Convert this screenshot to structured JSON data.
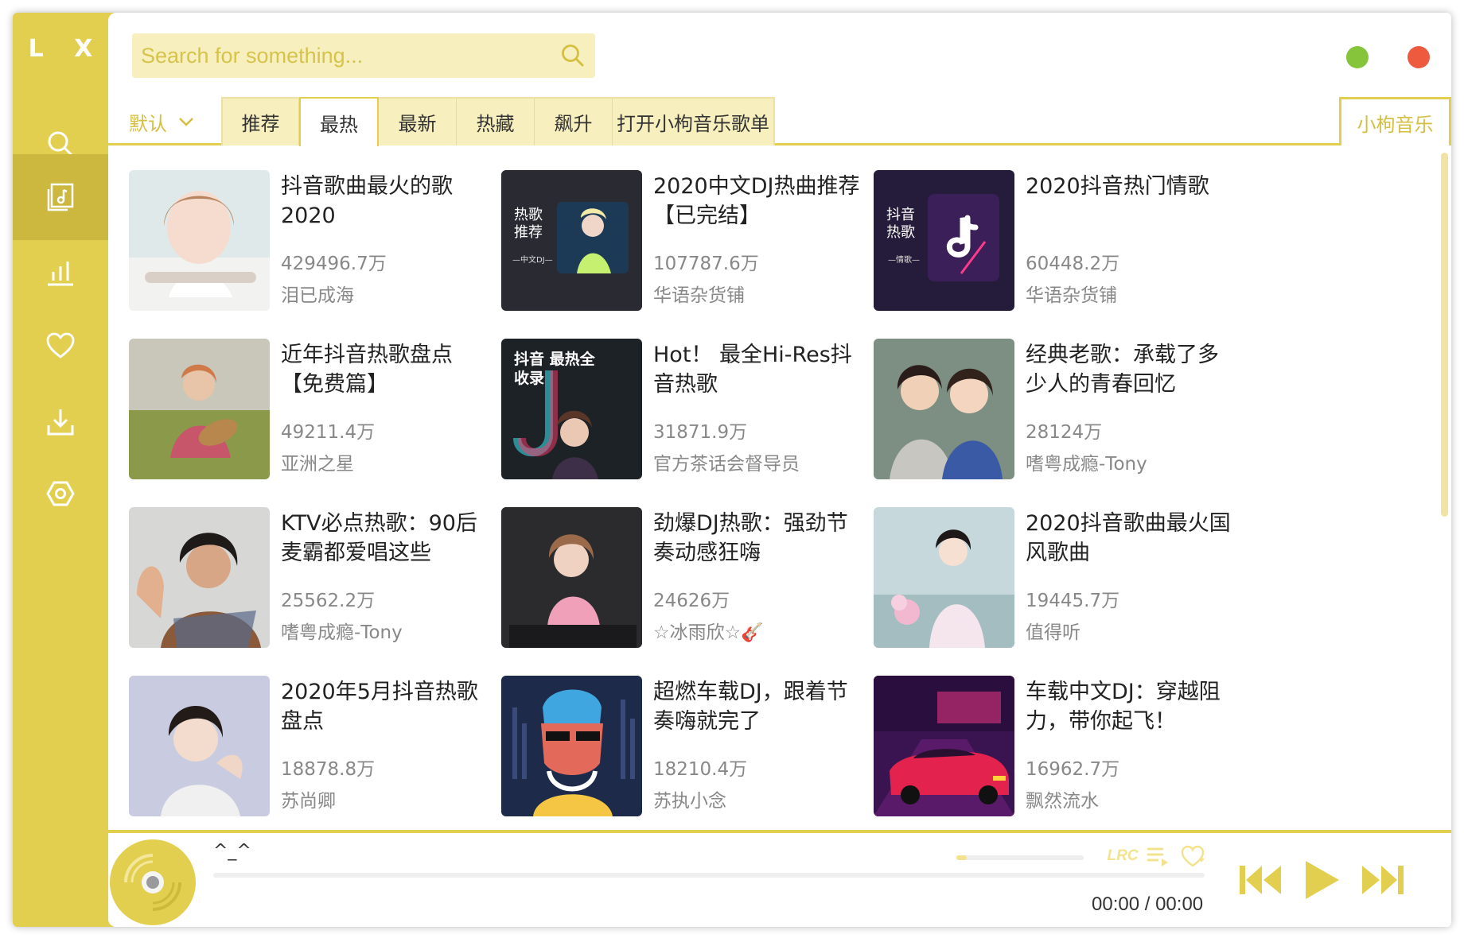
{
  "app": {
    "logo": "L X",
    "accent_color": "#e3cf4f"
  },
  "sidebar": {
    "items": [
      {
        "name": "search",
        "icon": "search-icon"
      },
      {
        "name": "song-list",
        "icon": "music-list-icon",
        "active": true
      },
      {
        "name": "leaderboard",
        "icon": "chart-bars-icon"
      },
      {
        "name": "favorites",
        "icon": "heart-icon"
      },
      {
        "name": "download",
        "icon": "download-icon"
      },
      {
        "name": "settings",
        "icon": "settings-icon"
      }
    ]
  },
  "search": {
    "placeholder": "Search for something..."
  },
  "window_controls": {
    "minimize_color": "#85c43b",
    "close_color": "#ee5a3e"
  },
  "tabs": {
    "sort_label": "默认",
    "items": [
      "推荐",
      "最热",
      "最新",
      "热藏",
      "飙升",
      "打开小枸音乐歌单"
    ],
    "active_index": 1,
    "source": "小枸音乐"
  },
  "playlists": [
    {
      "title": "抖音歌曲最火的歌2020",
      "count": "429496.7万",
      "author": "泪已成海"
    },
    {
      "title": "2020中文DJ热曲推荐【已完结】",
      "count": "107787.6万",
      "author": "华语杂货铺"
    },
    {
      "title": "2020抖音热门情歌",
      "count": "60448.2万",
      "author": "华语杂货铺"
    },
    {
      "title": "近年抖音热歌盘点【免费篇】",
      "count": "49211.4万",
      "author": "亚洲之星"
    },
    {
      "title": "Hot！ 最全Hi-Res抖音热歌",
      "count": "31871.9万",
      "author": "官方茶话会督导员"
    },
    {
      "title": "经典老歌：承载了多少人的青春回忆",
      "count": "28124万",
      "author": "嗜粤成瘾-Tony"
    },
    {
      "title": "KTV必点热歌：90后麦霸都爱唱这些",
      "count": "25562.2万",
      "author": "嗜粤成瘾-Tony"
    },
    {
      "title": "劲爆DJ热歌：强劲节奏动感狂嗨",
      "count": "24626万",
      "author": "☆冰雨欣☆🎸"
    },
    {
      "title": "2020抖音歌曲最火国风歌曲",
      "count": "19445.7万",
      "author": "值得听"
    },
    {
      "title": "2020年5月抖音热歌盘点",
      "count": "18878.8万",
      "author": "苏尚卿"
    },
    {
      "title": "超燃车载DJ，跟着节奏嗨就完了",
      "count": "18210.4万",
      "author": "苏执小念"
    },
    {
      "title": "车载中文DJ：穿越阻力，带你起飞！",
      "count": "16962.7万",
      "author": "飘然流水"
    }
  ],
  "covers": {
    "cover2_text": "热歌 推荐",
    "cover2_sub": "—中文DJ—",
    "cover3_text": "抖音 热歌",
    "cover3_sub": "—情歌—",
    "cover5_text": "抖音 最热全收录"
  },
  "player": {
    "song_name": "^_^",
    "time_current": "00:00",
    "time_total": "00:00",
    "progress": 0,
    "volume": 0.08,
    "lrc_label": "LRC"
  }
}
